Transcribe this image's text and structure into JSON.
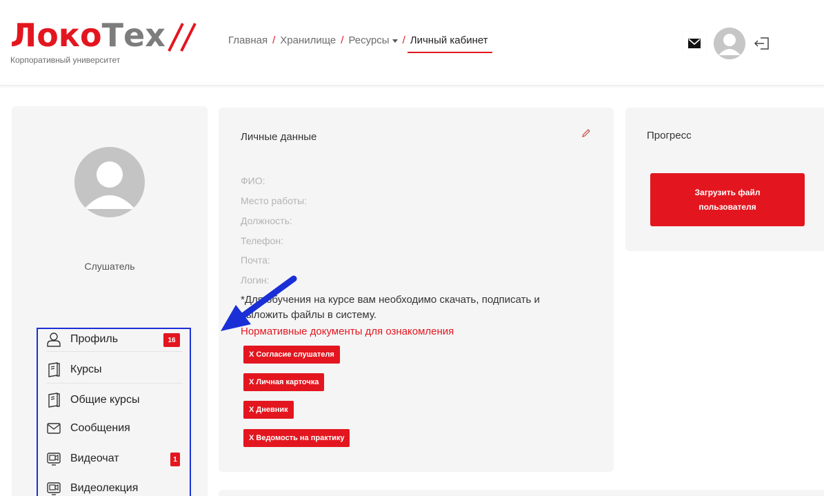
{
  "header": {
    "logo": {
      "brand_red": "Локо",
      "brand_gray": "Тех",
      "subtitle": "Корпоративный университет"
    },
    "nav": {
      "items": [
        {
          "label": "Главная"
        },
        {
          "label": "Хранилище"
        },
        {
          "label": "Ресурсы",
          "dropdown": true
        },
        {
          "label": "Личный кабинет",
          "active": true
        }
      ],
      "separator": "/"
    },
    "icons": [
      "mail-icon",
      "user-avatar",
      "logout-icon"
    ]
  },
  "sidebar": {
    "role": "Слушатель",
    "menu": [
      {
        "label": "Профиль",
        "icon": "user-icon",
        "badge": "16"
      },
      {
        "label": "Курсы",
        "icon": "book-icon"
      },
      {
        "label": "Общие курсы",
        "icon": "book-icon"
      },
      {
        "label": "Сообщения",
        "icon": "envelope-icon"
      },
      {
        "label": "Видеочат",
        "icon": "video-icon",
        "badge": "1"
      },
      {
        "label": "Видеолекция",
        "icon": "video-icon"
      }
    ]
  },
  "personal": {
    "title": "Личные данные",
    "fields": [
      {
        "label": "ФИО:"
      },
      {
        "label": "Место работы:"
      },
      {
        "label": "Должность:"
      },
      {
        "label": "Телефон:"
      },
      {
        "label": "Почта:"
      },
      {
        "label": "Логин:"
      }
    ],
    "note_line1": "*Для обучения на курсе вам необходимо скачать, подписать и",
    "note_line2": "выложить файлы в систему.",
    "docs_link": "Нормативные документы для ознакомления",
    "documents": [
      {
        "label": "Х Согласие слушателя"
      },
      {
        "label": "Х Личная карточка"
      },
      {
        "label": "Х Дневник"
      },
      {
        "label": "Х Ведомость на практику"
      }
    ]
  },
  "progress": {
    "title": "Прогресс",
    "upload_button": "Загрузить файл пользователя"
  },
  "colors": {
    "accent": "#e3161f",
    "highlight_box": "#1a2fd6",
    "arrow": "#1a2fd6",
    "card_bg": "#f5f5f5"
  }
}
